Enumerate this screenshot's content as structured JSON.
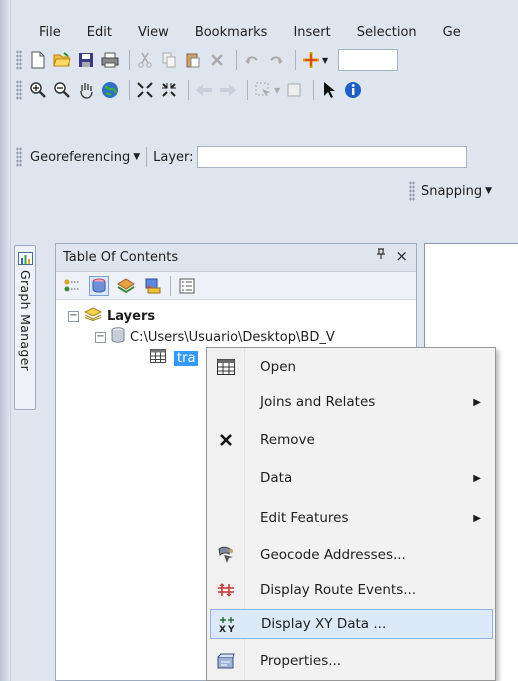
{
  "menu": {
    "items": [
      "File",
      "Edit",
      "View",
      "Bookmarks",
      "Insert",
      "Selection",
      "Ge"
    ]
  },
  "georef_toolbar": {
    "georeferencing_label": "Georeferencing",
    "layer_label": "Layer:"
  },
  "snapping": {
    "label": "Snapping"
  },
  "side_tab": {
    "label": "Graph Manager"
  },
  "toc": {
    "title": "Table Of Contents",
    "pin_glyph": "ᅟ",
    "close_glyph": "×",
    "tree": {
      "root_label": "Layers",
      "folder_label": "C:\\Users\\Usuario\\Desktop\\BD_V",
      "table_label": "tra"
    }
  },
  "context_menu": {
    "items": [
      {
        "label": "Open",
        "icon": "table-icon"
      },
      {
        "label": "Joins and Relates",
        "submenu": "▶"
      },
      {
        "label": "Remove",
        "icon": "close-icon"
      },
      {
        "label": "Data",
        "submenu": "▶"
      },
      {
        "label": "Edit Features",
        "submenu": "▶"
      },
      {
        "label": "Geocode Addresses...",
        "icon": "geocode-icon"
      },
      {
        "label": "Display Route Events...",
        "icon": "route-events-icon"
      },
      {
        "label": "Display XY Data ...",
        "icon": "xy-data-icon",
        "highlighted": true
      },
      {
        "label": "Properties...",
        "icon": "properties-icon"
      }
    ]
  },
  "colors": {
    "selection_blue": "#3399ff",
    "menu_highlight": "#dbe9f9",
    "frame_bg": "#dfe5ef"
  }
}
